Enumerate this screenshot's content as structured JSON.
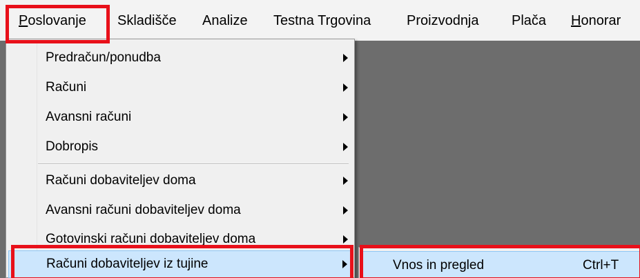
{
  "menubar": {
    "items": [
      {
        "label_mnemonic": "P",
        "label_rest": "oslovanje"
      },
      {
        "label": "Skladišče"
      },
      {
        "label": "Analize"
      },
      {
        "label": "Testna Trgovina"
      },
      {
        "label": "Proizvodnja"
      },
      {
        "label": "Plača"
      },
      {
        "label_mnemonic": "H",
        "label_rest": "onorar"
      }
    ]
  },
  "dropdown": {
    "items": [
      {
        "label": "Predračun/ponudba"
      },
      {
        "label": "Računi"
      },
      {
        "label": "Avansni računi"
      },
      {
        "label": "Dobropis"
      },
      {
        "label": "Računi dobaviteljev doma"
      },
      {
        "label": "Avansni računi dobaviteljev doma"
      },
      {
        "label": "Gotovinski računi dobaviteljev doma"
      },
      {
        "label": "Računi dobaviteljev iz tujine"
      }
    ]
  },
  "submenu": {
    "items": [
      {
        "label": "Vnos in pregled",
        "shortcut": "Ctrl+T"
      }
    ]
  },
  "colors": {
    "highlight": "#e8101a",
    "selection": "#cce6fd",
    "workspace": "#6d6d6d"
  }
}
